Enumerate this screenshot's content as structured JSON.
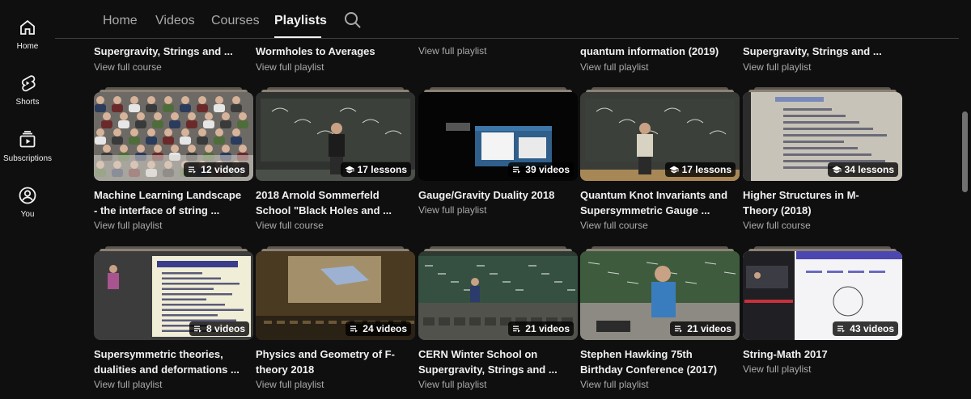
{
  "nav": {
    "items": [
      {
        "label": "Home",
        "icon": "home-icon"
      },
      {
        "label": "Shorts",
        "icon": "shorts-icon"
      },
      {
        "label": "Subscriptions",
        "icon": "subscriptions-icon"
      },
      {
        "label": "You",
        "icon": "you-icon"
      }
    ]
  },
  "tabs": [
    {
      "label": "Home",
      "active": false
    },
    {
      "label": "Videos",
      "active": false
    },
    {
      "label": "Courses",
      "active": false
    },
    {
      "label": "Playlists",
      "active": true
    }
  ],
  "top_row": [
    {
      "title": "Supergravity, Strings and ...",
      "link": "View full course"
    },
    {
      "title": "Wormholes to Averages",
      "link": "View full playlist"
    },
    {
      "title": "",
      "link": "View full playlist"
    },
    {
      "title": "quantum information (2019)",
      "link": "View full playlist"
    },
    {
      "title": "Supergravity, Strings and ...",
      "link": "View full playlist"
    }
  ],
  "row2": [
    {
      "badge": "12 videos",
      "title1": "Machine Learning Landscape",
      "title2": "- the interface of string ...",
      "link": "View full playlist",
      "kind": "playlist",
      "colors": {
        "bg": "#6d6a66",
        "accent": "#d9d4cc"
      }
    },
    {
      "badge": "17 lessons",
      "title1": "2018 Arnold Sommerfeld",
      "title2": "School \"Black Holes and ...",
      "link": "View full course",
      "kind": "course",
      "colors": {
        "bg": "#2f322e",
        "accent": "#4b4f49"
      }
    },
    {
      "badge": "39 videos",
      "title1": "Gauge/Gravity Duality 2018",
      "title2": "",
      "link": "View full playlist",
      "kind": "playlist",
      "colors": {
        "bg": "#050505",
        "accent": "#2f5f8a"
      }
    },
    {
      "badge": "17 lessons",
      "title1": "Quantum Knot Invariants and",
      "title2": "Supersymmetric Gauge ...",
      "link": "View full course",
      "kind": "course",
      "colors": {
        "bg": "#3a3d37",
        "accent": "#a88757"
      }
    },
    {
      "badge": "34 lessons",
      "title1": "Higher Structures in M-",
      "title2": "Theory (2018)",
      "link": "View full course",
      "kind": "course",
      "colors": {
        "bg": "#c8c3b8",
        "accent": "#7a8ab8"
      }
    }
  ],
  "row3": [
    {
      "badge": "8 videos",
      "title1": "Supersymmetric theories,",
      "title2": "dualities and deformations ...",
      "link": "View full playlist",
      "kind": "playlist",
      "colors": {
        "bg": "#3c3c3c",
        "accent": "#f0eed6"
      }
    },
    {
      "badge": "24 videos",
      "title1": "Physics and Geometry of F-",
      "title2": "theory 2018",
      "link": "View full playlist",
      "kind": "playlist",
      "colors": {
        "bg": "#4a3a22",
        "accent": "#c9b58a"
      }
    },
    {
      "badge": "21 videos",
      "title1": "CERN Winter School on",
      "title2": "Supergravity, Strings and ...",
      "link": "View full playlist",
      "kind": "playlist",
      "colors": {
        "bg": "#2d3a32",
        "accent": "#8a8b84"
      }
    },
    {
      "badge": "21 videos",
      "title1": "Stephen Hawking 75th",
      "title2": "Birthday Conference (2017)",
      "link": "View full playlist",
      "kind": "playlist",
      "colors": {
        "bg": "#3e4a3c",
        "accent": "#3a7dbf"
      }
    },
    {
      "badge": "43 videos",
      "title1": "String-Math 2017",
      "title2": "",
      "link": "View full playlist",
      "kind": "playlist",
      "colors": {
        "bg": "#f4f4f6",
        "accent": "#4b46b0"
      }
    }
  ]
}
